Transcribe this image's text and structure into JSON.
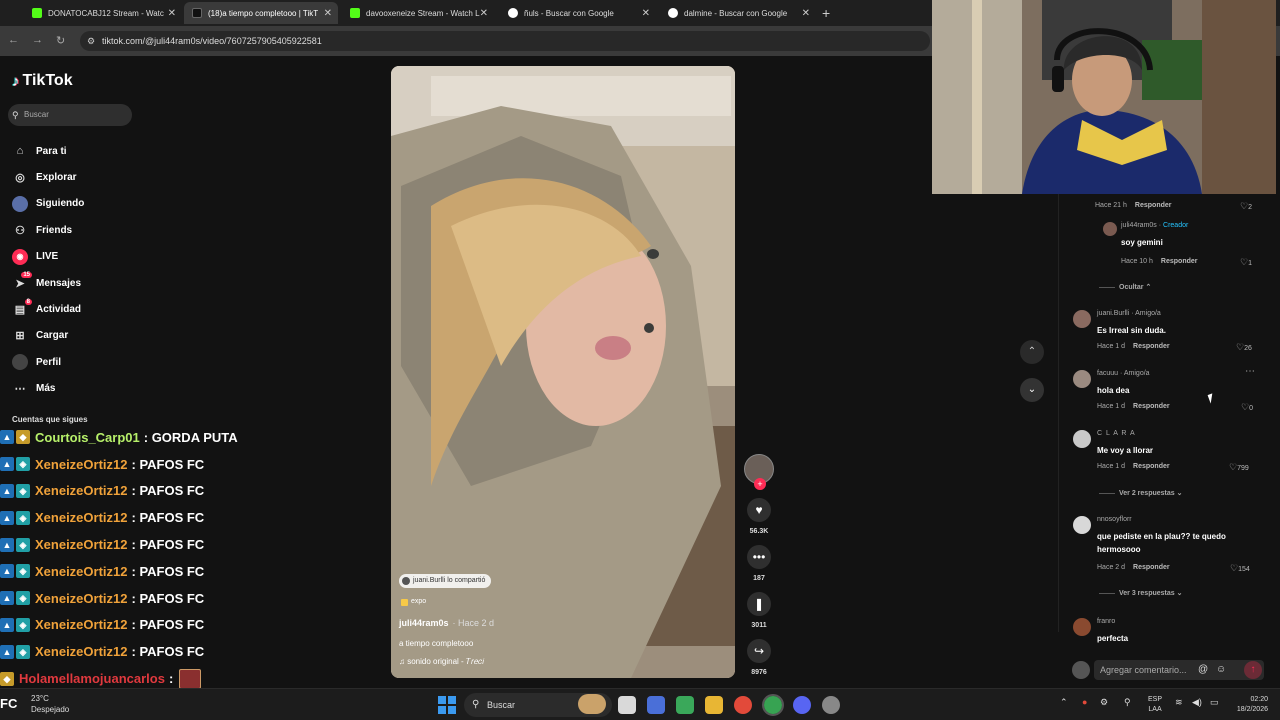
{
  "browser": {
    "tabs": [
      {
        "title": "DONATOCABJ12 Stream - Watc",
        "icon_color": "#53fc18"
      },
      {
        "title": "(18)a tiempo completooo | TikT",
        "icon_color": "#111111"
      },
      {
        "title": "davooxeneize Stream - Watch L",
        "icon_color": "#53fc18"
      },
      {
        "title": "ñuls - Buscar con Google",
        "icon_color": "#ffffff"
      },
      {
        "title": "dalmine - Buscar con Google",
        "icon_color": "#ffffff"
      }
    ],
    "new_tab": "+",
    "url": "tiktok.com/@juli44ram0s/video/7607257905405922581"
  },
  "tiktok": {
    "logo": "TikTok",
    "search_placeholder": "Buscar",
    "nav": [
      {
        "label": "Para ti",
        "icon": "home-icon",
        "glyph": "⌂"
      },
      {
        "label": "Explorar",
        "icon": "compass-icon",
        "glyph": "◎"
      },
      {
        "label": "Siguiendo",
        "icon": "following-avatar-icon",
        "glyph": "●"
      },
      {
        "label": "Friends",
        "icon": "friends-icon",
        "glyph": "⚇"
      },
      {
        "label": "LIVE",
        "icon": "live-icon",
        "glyph": "◉"
      },
      {
        "label": "Mensajes",
        "icon": "messages-icon",
        "glyph": "➤",
        "badge": "15"
      },
      {
        "label": "Actividad",
        "icon": "activity-icon",
        "glyph": "▤",
        "badge": "8"
      },
      {
        "label": "Cargar",
        "icon": "upload-icon",
        "glyph": "⊞"
      },
      {
        "label": "Perfil",
        "icon": "profile-avatar-icon",
        "glyph": "●"
      },
      {
        "label": "Más",
        "icon": "more-icon",
        "glyph": "⋯"
      }
    ],
    "following_title": "Cuentas que sigues",
    "video": {
      "shared_by": "juani.Burlli lo compartió",
      "tag": "expo",
      "author": "juli44ram0s",
      "age": "· Hace 2 d",
      "description": "a tiempo completooo",
      "sound": "♫  sonido original - 𝑇𝑟𝑒𝑐𝑖"
    },
    "actions": {
      "likes": "56.3K",
      "comments": "187",
      "saves": "3011",
      "shares": "8976"
    },
    "comments": [
      {
        "type": "meta_only",
        "time": "Hace 21 h",
        "reply": "Responder",
        "likes": "2"
      },
      {
        "user": "juli44ram0s",
        "role": "Creador",
        "text": "soy gemini",
        "time": "Hace 10 h",
        "reply": "Responder",
        "likes": "1"
      },
      {
        "type": "toggle",
        "label": "Ocultar ⌃"
      },
      {
        "user": "juani.Burlli",
        "role": "Amigo/a",
        "text": "Es Irreal sin duda.",
        "time": "Hace 1 d",
        "reply": "Responder",
        "likes": "26"
      },
      {
        "user": "facuuu",
        "role": "Amigo/a",
        "text": "hola dea",
        "time": "Hace 1 d",
        "reply": "Responder",
        "likes": "0"
      },
      {
        "user": "C L A R A",
        "role": "",
        "text": "Me voy a llorar",
        "time": "Hace 1 d",
        "reply": "Responder",
        "likes": "799",
        "more": "Ver 2 respuestas ⌄"
      },
      {
        "user": "nnosoyflorr",
        "role": "",
        "text": "que pediste en la plau?? te quedo hermosooo",
        "time": "Hace 2 d",
        "reply": "Responder",
        "likes": "154",
        "more": "Ver 3 respuestas ⌄"
      },
      {
        "user": "franro",
        "role": "",
        "text": "perfecta"
      }
    ],
    "add_comment_placeholder": "Agregar comentario..."
  },
  "stream_chat": [
    {
      "user": "Courtois_Carp01",
      "msg": ": GORDA PUTA",
      "color": "#b7f06a"
    },
    {
      "user": "XeneizeOrtiz12",
      "msg": ": PAFOS FC",
      "color": "#f0a23a"
    },
    {
      "user": "XeneizeOrtiz12",
      "msg": ": PAFOS FC",
      "color": "#f0a23a"
    },
    {
      "user": "XeneizeOrtiz12",
      "msg": ": PAFOS FC",
      "color": "#f0a23a"
    },
    {
      "user": "XeneizeOrtiz12",
      "msg": ": PAFOS FC",
      "color": "#f0a23a"
    },
    {
      "user": "XeneizeOrtiz12",
      "msg": ": PAFOS FC",
      "color": "#f0a23a"
    },
    {
      "user": "XeneizeOrtiz12",
      "msg": ": PAFOS FC",
      "color": "#f0a23a"
    },
    {
      "user": "XeneizeOrtiz12",
      "msg": ": PAFOS FC",
      "color": "#f0a23a"
    },
    {
      "user": "XeneizeOrtiz12",
      "msg": ": PAFOS FC",
      "color": "#f0a23a"
    },
    {
      "user": "Holamellamojuancarlos",
      "msg": ":",
      "color": "#e0393e"
    }
  ],
  "taskbar": {
    "weather_logo": "FC",
    "temp": "23°C",
    "condition": "Despejado",
    "search": "Buscar",
    "lang_top": "ESP",
    "lang_bottom": "LAA",
    "time": "02:20",
    "date": "18/2/2026"
  }
}
